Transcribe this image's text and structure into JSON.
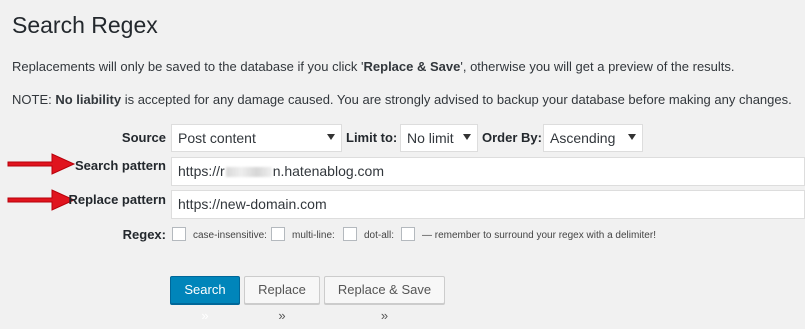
{
  "page": {
    "title": "Search Regex",
    "notice_prefix": "Replacements will only be saved to the database if you click '",
    "notice_bold": "Replace & Save",
    "notice_suffix": "', otherwise you will get a preview of the results.",
    "warning_prefix": "NOTE: ",
    "warning_bold": "No liability",
    "warning_suffix": " is accepted for any damage caused. You are strongly advised to backup your database before making any changes."
  },
  "form": {
    "source_label": "Source",
    "source_value": "Post content",
    "limit_label": "Limit to:",
    "limit_value": "No limit",
    "order_label": "Order By:",
    "order_value": "Ascending",
    "search_label": "Search pattern",
    "search_value_prefix": "https://r",
    "search_value_suffix": "n.hatenablog.com",
    "replace_label": "Replace pattern",
    "replace_value": "https://new-domain.com",
    "regex_label": "Regex:",
    "case_insensitive_label": "case-insensitive:",
    "multi_line_label": "multi-line:",
    "dot_all_label": "dot-all:",
    "delimiter_note": "— remember to surround your regex with a delimiter!"
  },
  "buttons": {
    "search": "Search »",
    "replace": "Replace »",
    "replace_save": "Replace & Save »"
  },
  "colors": {
    "primary": "#0085ba",
    "arrow": "#e0141e"
  }
}
